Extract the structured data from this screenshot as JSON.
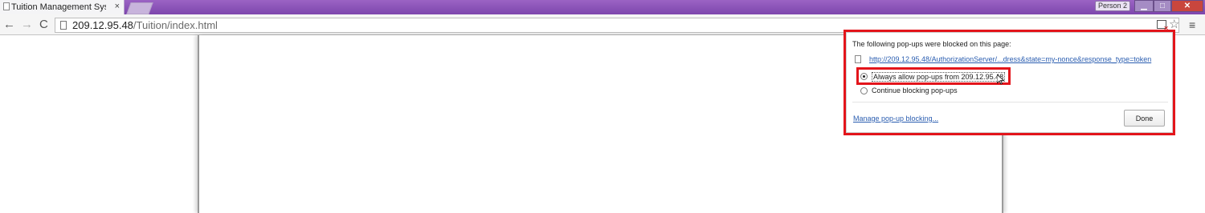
{
  "browser": {
    "tab_title": "Tuition Management Syst",
    "tab_close": "×",
    "profile_label": "Person 2",
    "window_controls": {
      "minimize": "▁",
      "maximize": "□",
      "close": "✕"
    }
  },
  "toolbar": {
    "back_glyph": "←",
    "forward_glyph": "→",
    "reload_glyph": "C",
    "url_host": "209.12.95.48",
    "url_path": "/Tuition/index.html",
    "star_glyph": "☆",
    "menu_glyph": "≡"
  },
  "icons": {
    "tab_page": "page-icon",
    "omnibox_page": "page-icon",
    "popup_blocked": "popup-blocked-icon",
    "bookmark": "star-icon",
    "menu": "hamburger-icon",
    "cursor": "mouse-cursor-icon"
  },
  "popup_bubble": {
    "heading": "The following pop-ups were blocked on this page:",
    "blocked_link": "http://209.12.95.48/AuthorizationServer/...dress&state=my-nonce&response_type=token",
    "option_allow": "Always allow pop-ups from 209.12.95.48",
    "option_block": "Continue blocking pop-ups",
    "selected_option": "option_allow",
    "manage_link": "Manage pop-up blocking...",
    "done_label": "Done"
  },
  "colors": {
    "title_bar": "#8b55b8",
    "highlight_outline": "#e3151b",
    "link": "#2a5db0"
  }
}
